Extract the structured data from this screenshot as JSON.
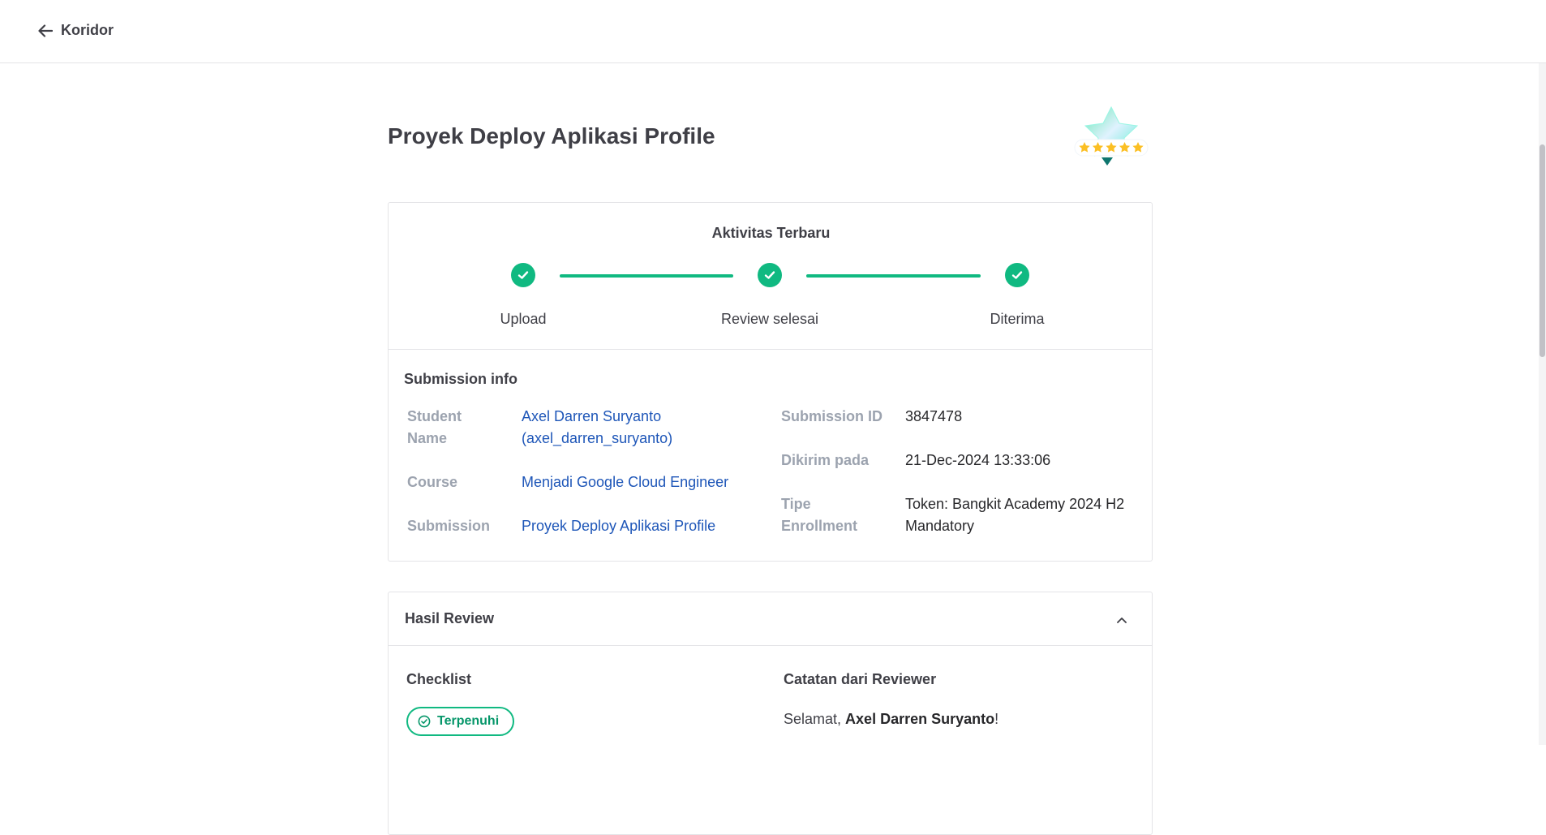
{
  "header": {
    "back_label": "Koridor"
  },
  "page": {
    "title": "Proyek Deploy Aplikasi Profile"
  },
  "activity": {
    "title": "Aktivitas Terbaru",
    "steps": [
      {
        "label": "Upload"
      },
      {
        "label": "Review selesai"
      },
      {
        "label": "Diterima"
      }
    ]
  },
  "submission_info": {
    "title": "Submission info",
    "student_name_label_1": "Student",
    "student_name_label_2": "Name",
    "student_name": "Axel Darren Suryanto",
    "student_username": "(axel_darren_suryanto)",
    "course_label": "Course",
    "course": "Menjadi Google Cloud Engineer",
    "submission_label": "Submission",
    "submission": "Proyek Deploy Aplikasi Profile",
    "submission_id_label": "Submission ID",
    "submission_id": "3847478",
    "sent_label": "Dikirim pada",
    "sent": "21-Dec-2024 13:33:06",
    "enrollment_label_1": "Tipe",
    "enrollment_label_2": "Enrollment",
    "enrollment_1": "Token: Bangkit Academy 2024 H2",
    "enrollment_2": "Mandatory"
  },
  "review": {
    "title": "Hasil Review",
    "checklist_title": "Checklist",
    "checklist_status": "Terpenuhi",
    "notes_title": "Catatan dari Reviewer",
    "notes_greeting": "Selamat, ",
    "notes_name": "Axel Darren Suryanto",
    "notes_end": "!"
  },
  "colors": {
    "accent": "#10b981",
    "link": "#1e56b8",
    "star": "#fbbf24"
  }
}
